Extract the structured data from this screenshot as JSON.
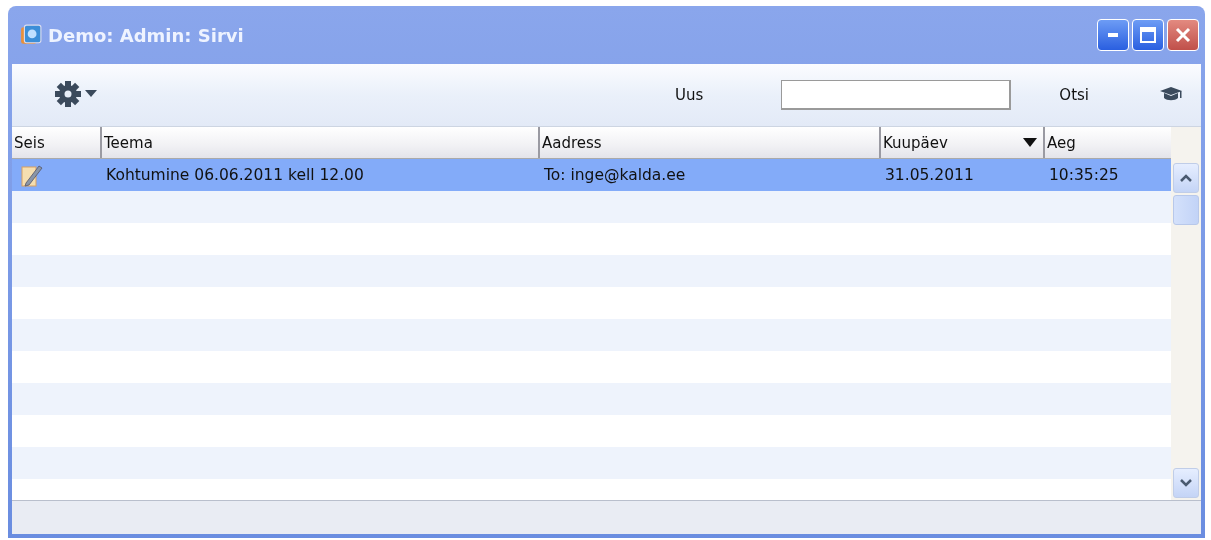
{
  "window": {
    "title": "Demo: Admin: Sirvi"
  },
  "toolbar": {
    "new_button": "Uus",
    "search_button": "Otsi"
  },
  "table": {
    "columns": [
      {
        "label": "Seis",
        "sorted": false
      },
      {
        "label": "Teema",
        "sorted": false
      },
      {
        "label": "Aadress",
        "sorted": false
      },
      {
        "label": "Kuupäev",
        "sorted": true
      },
      {
        "label": "Aeg",
        "sorted": false
      }
    ],
    "rows": [
      {
        "selected": true,
        "kind": "draft",
        "cells": [
          "",
          "Kohtumine 06.06.2011 kell 12.00",
          "To: inge@kalda.ee",
          "31.05.2011",
          "10:35:25"
        ]
      }
    ]
  }
}
